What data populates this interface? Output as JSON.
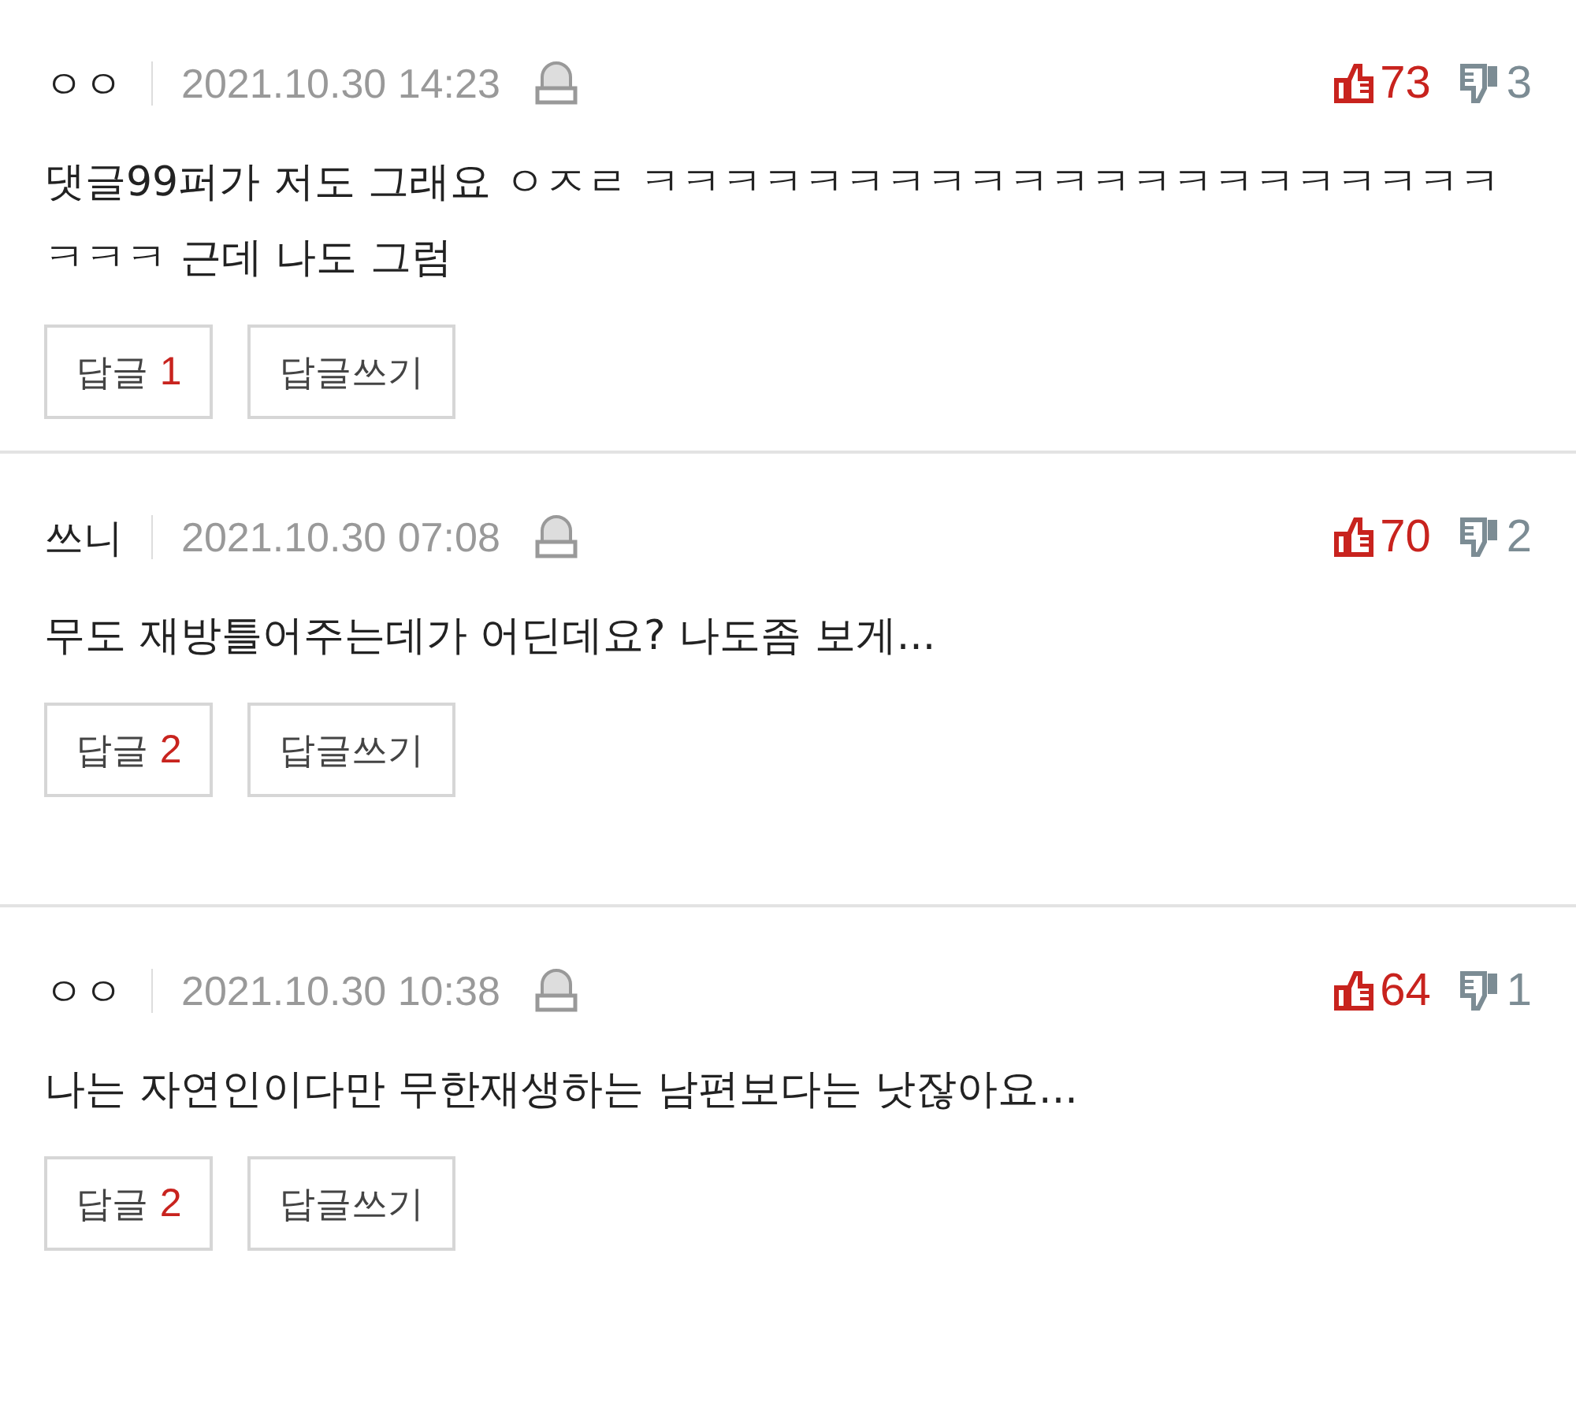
{
  "comments": [
    {
      "author": "ㅇㅇ",
      "date": "2021.10.30 14:23",
      "likes": "73",
      "dislikes": "3",
      "text": "댓글99퍼가 저도 그래요 ㅇㅈㄹ ㅋㅋㅋㅋㅋㅋㅋㅋㅋㅋㅋㅋㅋㅋㅋㅋㅋㅋㅋㅋㅋㅋㅋㅋ 근데 나도 그럼",
      "reply_label": "답글",
      "reply_count": "1",
      "write_label": "답글쓰기"
    },
    {
      "author": "쓰니",
      "date": "2021.10.30 07:08",
      "likes": "70",
      "dislikes": "2",
      "text": "무도 재방틀어주는데가 어딘데요? 나도좀 보게...",
      "reply_label": "답글",
      "reply_count": "2",
      "write_label": "답글쓰기"
    },
    {
      "author": "ㅇㅇ",
      "date": "2021.10.30 10:38",
      "likes": "64",
      "dislikes": "1",
      "text": "나는 자연인이다만 무한재생하는 남편보다는 낫잖아요...",
      "reply_label": "답글",
      "reply_count": "2",
      "write_label": "답글쓰기"
    }
  ]
}
